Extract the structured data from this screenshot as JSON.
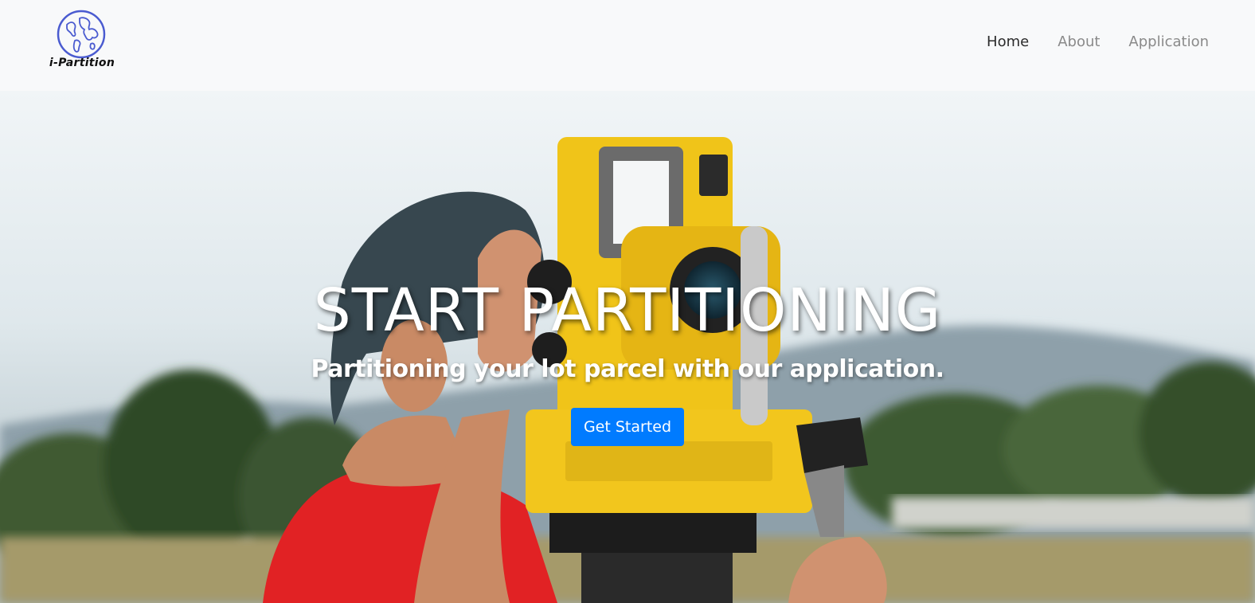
{
  "brand": {
    "name": "i-Partition",
    "icon": "globe-icon",
    "accent_color": "#4a5bd0"
  },
  "nav": {
    "items": [
      {
        "label": "Home",
        "active": true
      },
      {
        "label": "About",
        "active": false
      },
      {
        "label": "Application",
        "active": false
      }
    ]
  },
  "hero": {
    "title": "START PARTITIONING",
    "subtitle": "Partitioning your lot parcel with our application.",
    "cta_label": "Get Started",
    "cta_color": "#007bff"
  }
}
